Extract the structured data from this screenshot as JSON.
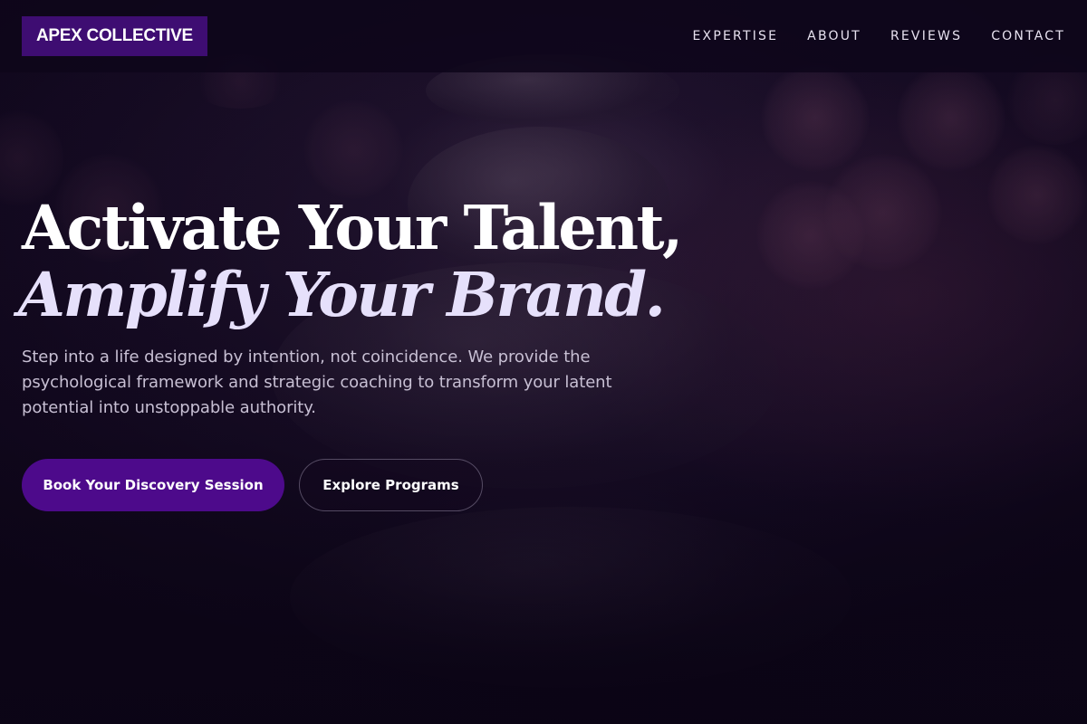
{
  "brand": {
    "logo_text": "APEX COLLECTIVE",
    "accent_color": "#3e0d72"
  },
  "nav": {
    "items": [
      {
        "label": "EXPERTISE"
      },
      {
        "label": "ABOUT"
      },
      {
        "label": "REVIEWS"
      },
      {
        "label": "CONTACT"
      }
    ]
  },
  "hero": {
    "headline_line1": "Activate Your Talent,",
    "headline_line2": "Amplify Your Brand.",
    "subtitle": "Step into a life designed by intention, not coincidence. We provide the psychological framework and strategic coaching to transform your latent potential into unstoppable authority.",
    "primary_cta": "Book Your Discovery Session",
    "secondary_cta": "Explore Programs",
    "primary_color": "#4d0a8b",
    "background_image": "stacked-stones-bokeh"
  }
}
